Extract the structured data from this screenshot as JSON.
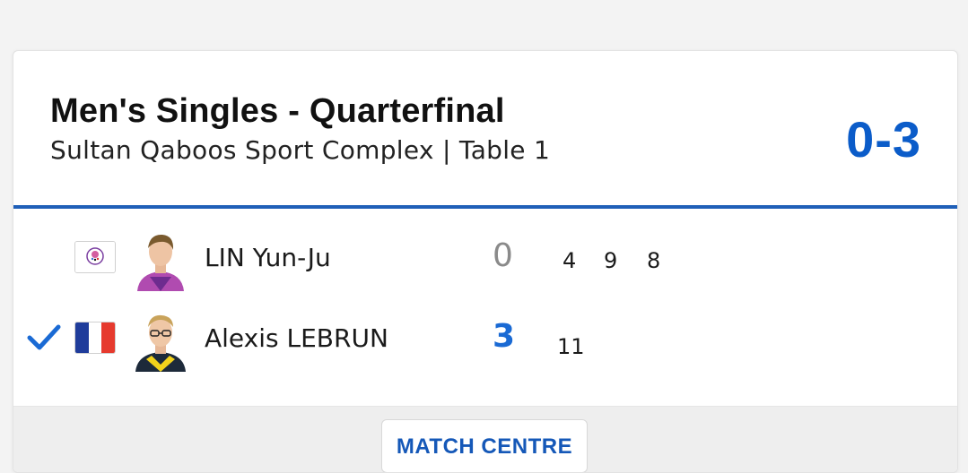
{
  "match": {
    "title": "Men's Singles - Quarterfinal",
    "venue": "Sultan Qaboos Sport Complex | Table 1",
    "score": "0-3"
  },
  "players": [
    {
      "name": "LIN Yun-Ju",
      "flag_icon": "chinese-taipei-flag-icon",
      "games": "0",
      "points": [
        "4",
        "9",
        "8"
      ],
      "winner": false
    },
    {
      "name": "Alexis LEBRUN",
      "flag_icon": "france-flag-icon",
      "games": "3",
      "points": [
        "11"
      ],
      "winner": true
    }
  ],
  "footer": {
    "match_centre_label": "MATCH CENTRE"
  },
  "colors": {
    "accent": "#0b5cc9",
    "divider": "#1f5fb8",
    "france_blue": "#1f3c9b",
    "france_red": "#e63a2e"
  }
}
